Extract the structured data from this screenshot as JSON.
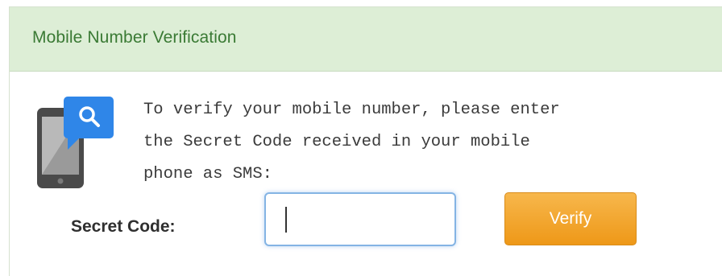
{
  "panel": {
    "title": "Mobile Number Verification"
  },
  "icon": {
    "name": "mobile-search-icon",
    "phone_color": "#4a4a4a",
    "badge_color": "#2f86e8"
  },
  "instructions": {
    "line1": "To verify your mobile number, please enter",
    "line2": "the Secret Code received in your mobile",
    "line3": "phone as SMS:"
  },
  "form": {
    "secret_label": "Secret Code:",
    "secret_value": "",
    "verify_label": "Verify"
  },
  "colors": {
    "header_bg": "#ddeed6",
    "title_text": "#3a7a34",
    "verify_button": "#f3a632",
    "input_focus_border": "#84b4e4"
  }
}
